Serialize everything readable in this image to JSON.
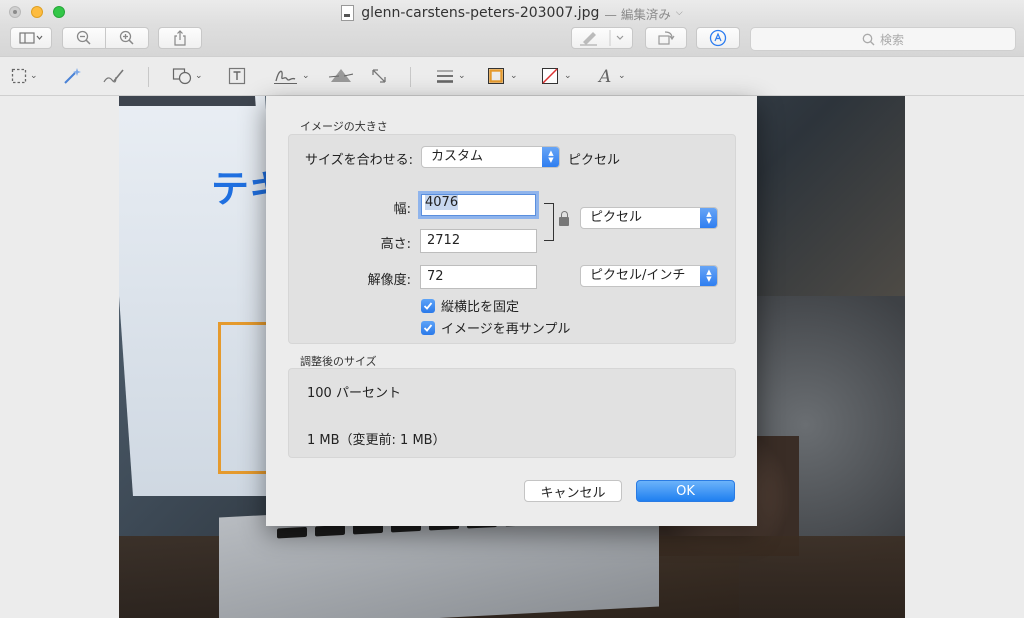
{
  "window": {
    "filename": "glenn-carstens-peters-203007.jpg",
    "status": "— 編集済み"
  },
  "toolbar": {
    "search_placeholder": "検索"
  },
  "background_image": {
    "screen_text": "テキ"
  },
  "dialog": {
    "image_size_title": "イメージの大きさ",
    "fit_label": "サイズを合わせる:",
    "fit_value": "カスタム",
    "fit_unit": "ピクセル",
    "width_label": "幅:",
    "width_value": "4076",
    "height_label": "高さ:",
    "height_value": "2712",
    "dimension_unit": "ピクセル",
    "resolution_label": "解像度:",
    "resolution_value": "72",
    "resolution_unit": "ピクセル/インチ",
    "scale_proportionally": "縦横比を固定",
    "scale_checked": true,
    "resample": "イメージを再サンプル",
    "resample_checked": true,
    "result_title": "調整後のサイズ",
    "result_percent": "100 パーセント",
    "result_size": "1 MB（変更前: 1 MB）",
    "cancel_label": "キャンセル",
    "ok_label": "OK"
  },
  "colors": {
    "accent": "#2c7cf0",
    "focus_ring": "#8fb4ec",
    "highlight_box": "#e59a2d"
  }
}
